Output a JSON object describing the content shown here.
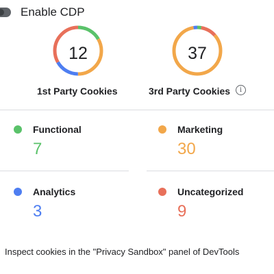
{
  "header": {
    "toggle_state": "off",
    "title": "Enable CDP"
  },
  "colors": {
    "functional": "#5ac26a",
    "marketing": "#f2a74a",
    "analytics": "#4e7ef1",
    "uncategorized": "#e8705a"
  },
  "first_party": {
    "count": "12",
    "label": "1st Party Cookies",
    "segments": [
      {
        "category": "functional",
        "value": 2
      },
      {
        "category": "marketing",
        "value": 4
      },
      {
        "category": "analytics",
        "value": 2
      },
      {
        "category": "uncategorized",
        "value": 4
      }
    ]
  },
  "third_party": {
    "count": "37",
    "label": "3rd Party Cookies",
    "info_icon": "info-icon",
    "segments": [
      {
        "category": "functional",
        "value": 1
      },
      {
        "category": "uncategorized",
        "value": 4
      },
      {
        "category": "marketing",
        "value": 31
      },
      {
        "category": "analytics",
        "value": 1
      }
    ]
  },
  "categories": {
    "functional": {
      "label": "Functional",
      "value": "7"
    },
    "marketing": {
      "label": "Marketing",
      "value": "30"
    },
    "analytics": {
      "label": "Analytics",
      "value": "3"
    },
    "uncategorized": {
      "label": "Uncategorized",
      "value": "9"
    }
  },
  "footer": {
    "text": "Inspect cookies in the \"Privacy Sandbox\" panel of DevTools"
  }
}
